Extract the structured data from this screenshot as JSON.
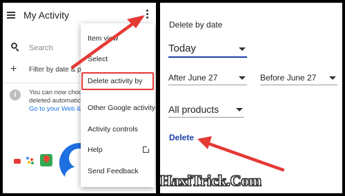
{
  "left": {
    "title": "My Activity",
    "search_placeholder": "Search",
    "filter_label": "Filter by date & prod",
    "info_line1": "You can now choo",
    "info_line2": "deleted automatic",
    "info_link": "Go to your Web &"
  },
  "menu": {
    "items": [
      {
        "label": "Item view"
      },
      {
        "label": "Select"
      },
      {
        "label": "Delete activity by"
      },
      {
        "label": "Other Google activity"
      },
      {
        "label": "Activity controls"
      },
      {
        "label": "Help"
      },
      {
        "label": "Send Feedback"
      }
    ],
    "highlight_color": "#e53935"
  },
  "right": {
    "heading": "Delete by date",
    "date_value": "Today",
    "after_value": "After June 27",
    "before_value": "Before June 27",
    "products_value": "All products",
    "delete_label": "Delete",
    "accent_color": "#1a3fa8"
  },
  "watermark": "HaxiTrick.Com",
  "arrow_color": "#e53935"
}
